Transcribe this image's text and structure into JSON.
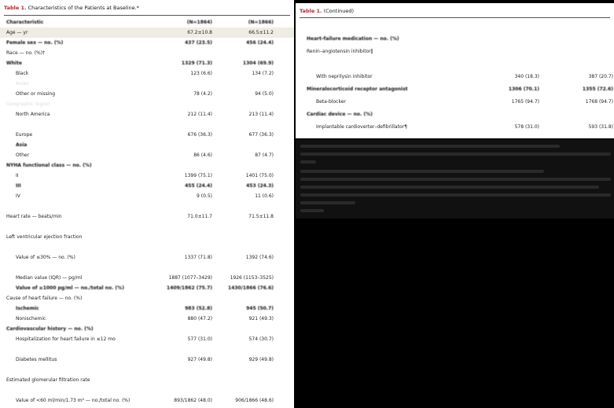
{
  "left": {
    "title_label": "Table 1.",
    "title_text": " Characteristics of the Patients at Baseline.*",
    "rows": [
      {
        "label": "Characteristic",
        "a": "(N=1864)",
        "b": "(N=1866)",
        "style": "smear"
      },
      {
        "label": "Age — yr",
        "a": "67.2±10.8",
        "b": "66.5±11.2",
        "style": "alt"
      },
      {
        "label": "Female sex — no. (%)",
        "a": "437 (23.5)",
        "b": "456 (24.4)",
        "style": "smear"
      },
      {
        "label": "Race — no. (%)†",
        "a": "",
        "b": "",
        "style": ""
      },
      {
        "label": "White",
        "a": "1329 (71.3)",
        "b": "1304 (69.9)",
        "style": "smear"
      },
      {
        "label": "Black",
        "a": "123 (6.6)",
        "b": "134 (7.2)",
        "style": ""
      },
      {
        "label": "Asian",
        "a": "",
        "b": "",
        "style": "blank"
      },
      {
        "label": "Other or missing",
        "a": "78 (4.2)",
        "b": "94 (5.0)",
        "style": ""
      },
      {
        "label": "Geographic region",
        "a": "",
        "b": "",
        "style": "blank"
      },
      {
        "label": "North America",
        "a": "212 (11.4)",
        "b": "213 (11.4)",
        "style": ""
      },
      {
        "label": "",
        "a": "",
        "b": "",
        "style": "blank"
      },
      {
        "label": "Europe",
        "a": "676 (36.3)",
        "b": "677 (36.3)",
        "style": ""
      },
      {
        "label": "Asia",
        "a": "",
        "b": "",
        "style": "smear"
      },
      {
        "label": "Other",
        "a": "86 (4.6)",
        "b": "87 (4.7)",
        "style": ""
      },
      {
        "label": "NYHA functional class — no. (%)",
        "a": "",
        "b": "",
        "style": "smear"
      },
      {
        "label": "II",
        "a": "1399 (75.1)",
        "b": "1401 (75.0)",
        "style": ""
      },
      {
        "label": "III",
        "a": "455 (24.4)",
        "b": "453 (24.3)",
        "style": "smear"
      },
      {
        "label": "IV",
        "a": "9 (0.5)",
        "b": "11 (0.6)",
        "style": ""
      },
      {
        "label": "",
        "a": "",
        "b": "",
        "style": "blank"
      },
      {
        "label": "Heart rate — beats/min",
        "a": "71.0±11.7",
        "b": "71.5±11.8",
        "style": ""
      },
      {
        "label": "",
        "a": "",
        "b": "",
        "style": "blank"
      },
      {
        "label": "Left ventricular ejection fraction",
        "a": "",
        "b": "",
        "style": ""
      },
      {
        "label": "",
        "a": "",
        "b": "",
        "style": "blank"
      },
      {
        "label": "Value of ≤30% — no. (%)",
        "a": "1337 (71.8)",
        "b": "1392 (74.6)",
        "style": ""
      },
      {
        "label": "",
        "a": "",
        "b": "",
        "style": "blank"
      },
      {
        "label": "Median value (IQR) — pg/ml",
        "a": "1887 (1077–3429)",
        "b": "1926 (1153–3525)",
        "style": ""
      },
      {
        "label": "Value of ≥1000 pg/ml — no./total no. (%)",
        "a": "1409/1862 (75.7)",
        "b": "1430/1866 (76.6)",
        "style": "smear"
      },
      {
        "label": "Cause of heart failure — no. (%)",
        "a": "",
        "b": "",
        "style": ""
      },
      {
        "label": "Ischemic",
        "a": "983 (52.8)",
        "b": "945 (50.7)",
        "style": "smear"
      },
      {
        "label": "Nonischemic",
        "a": "880 (47.2)",
        "b": "921 (49.3)",
        "style": ""
      },
      {
        "label": "Cardiovascular history — no. (%)",
        "a": "",
        "b": "",
        "style": "smear"
      },
      {
        "label": "Hospitalization for heart failure in ≤12 mo",
        "a": "577 (31.0)",
        "b": "574 (30.7)",
        "style": ""
      },
      {
        "label": "",
        "a": "",
        "b": "",
        "style": "blank"
      },
      {
        "label": "Diabetes mellitus",
        "a": "927 (49.8)",
        "b": "929 (49.8)",
        "style": ""
      },
      {
        "label": "",
        "a": "",
        "b": "",
        "style": "blank"
      },
      {
        "label": "Estimated glomerular filtration rate",
        "a": "",
        "b": "",
        "style": ""
      },
      {
        "label": "",
        "a": "",
        "b": "",
        "style": "blank"
      },
      {
        "label": "Value of <60 ml/min/1.73 m² — no./total no. (%)",
        "a": "893/1862 (48.0)",
        "b": "906/1866 (48.6)",
        "style": ""
      }
    ]
  },
  "right": {
    "title_label": "Table 1.",
    "title_text": " (Continued)",
    "rows": [
      {
        "label": "",
        "a": "",
        "b": "",
        "style": "blank"
      },
      {
        "label": "Heart-failure medication — no. (%)",
        "a": "",
        "b": "",
        "style": "smear"
      },
      {
        "label": "Renin–angiotensin inhibitor‖",
        "a": "",
        "b": "",
        "style": ""
      },
      {
        "label": "",
        "a": "",
        "b": "",
        "style": "blank"
      },
      {
        "label": "With neprilysin inhibitor",
        "a": "340 (18.3)",
        "b": "387 (20.7)",
        "style": ""
      },
      {
        "label": "Mineralocorticoid receptor antagonist",
        "a": "1306 (70.1)",
        "b": "1355 (72.6)",
        "style": "smear"
      },
      {
        "label": "Beta-blocker",
        "a": "1765 (94.7)",
        "b": "1768 (94.7)",
        "style": ""
      },
      {
        "label": "Cardiac device — no. (%)",
        "a": "",
        "b": "",
        "style": "smear"
      },
      {
        "label": "Implantable cardioverter–defibrillator¶",
        "a": "578 (31.0)",
        "b": "593 (31.8)",
        "style": ""
      }
    ]
  }
}
